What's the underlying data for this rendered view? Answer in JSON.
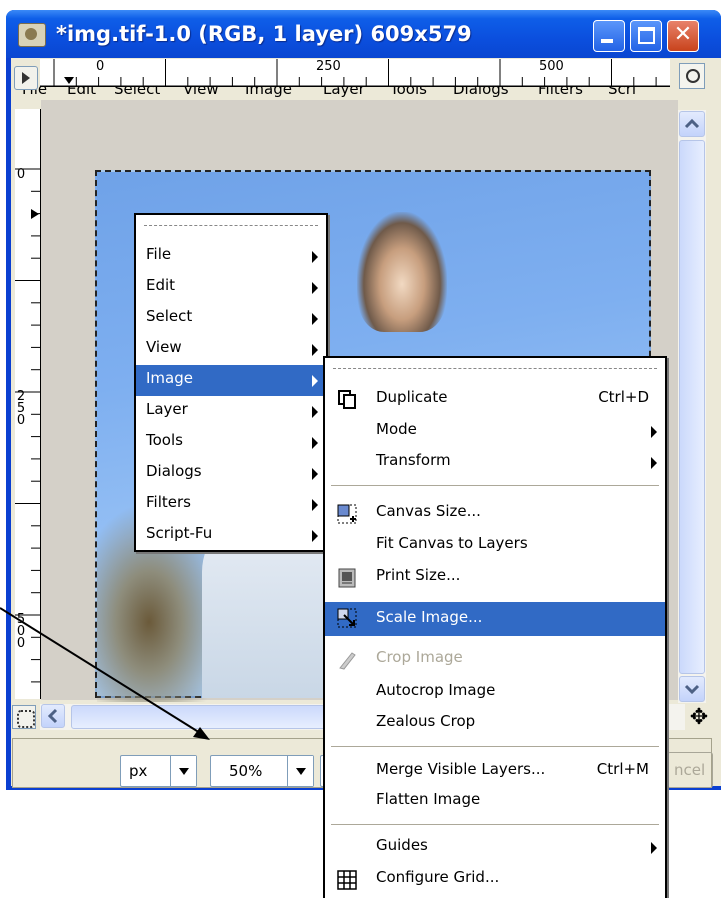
{
  "window": {
    "title": "*img.tif-1.0 (RGB, 1 layer) 609x579",
    "menubar": [
      "File",
      "Edit",
      "Select",
      "View",
      "Image",
      "Layer",
      "Tools",
      "Dialogs",
      "Filters",
      "Scri"
    ]
  },
  "rulers": {
    "horizontal_labels": [
      "0",
      "250",
      "500"
    ],
    "vertical_labels": [
      "0",
      "2\n5\n0",
      "5\n0\n0"
    ]
  },
  "status": {
    "unit": "px",
    "zoom": "50%",
    "cancel_label": "ncel"
  },
  "context_menu": {
    "items": [
      "File",
      "Edit",
      "Select",
      "View",
      "Image",
      "Layer",
      "Tools",
      "Dialogs",
      "Filters",
      "Script-Fu"
    ],
    "highlighted": "Image"
  },
  "image_submenu": {
    "items": [
      {
        "label": "Duplicate",
        "accel": "Ctrl+D",
        "icon": "duplicate-icon"
      },
      {
        "label": "Mode",
        "submenu": true
      },
      {
        "label": "Transform",
        "submenu": true
      },
      {
        "label": "Canvas Size...",
        "icon": "canvas-size-icon"
      },
      {
        "label": "Fit Canvas to Layers"
      },
      {
        "label": "Print Size...",
        "icon": "print-size-icon"
      },
      {
        "label": "Scale Image...",
        "icon": "scale-image-icon",
        "highlighted": true
      },
      {
        "label": "Crop Image",
        "icon": "crop-icon",
        "disabled": true
      },
      {
        "label": "Autocrop Image"
      },
      {
        "label": "Zealous Crop"
      },
      {
        "label": "Merge Visible Layers...",
        "accel": "Ctrl+M"
      },
      {
        "label": "Flatten Image"
      },
      {
        "label": "Guides",
        "submenu": true
      },
      {
        "label": "Configure Grid...",
        "icon": "grid-icon"
      }
    ]
  },
  "colors": {
    "title_bar": "#0b4fde",
    "menu_highlight": "#316ac5",
    "disabled_text": "#aca899"
  }
}
